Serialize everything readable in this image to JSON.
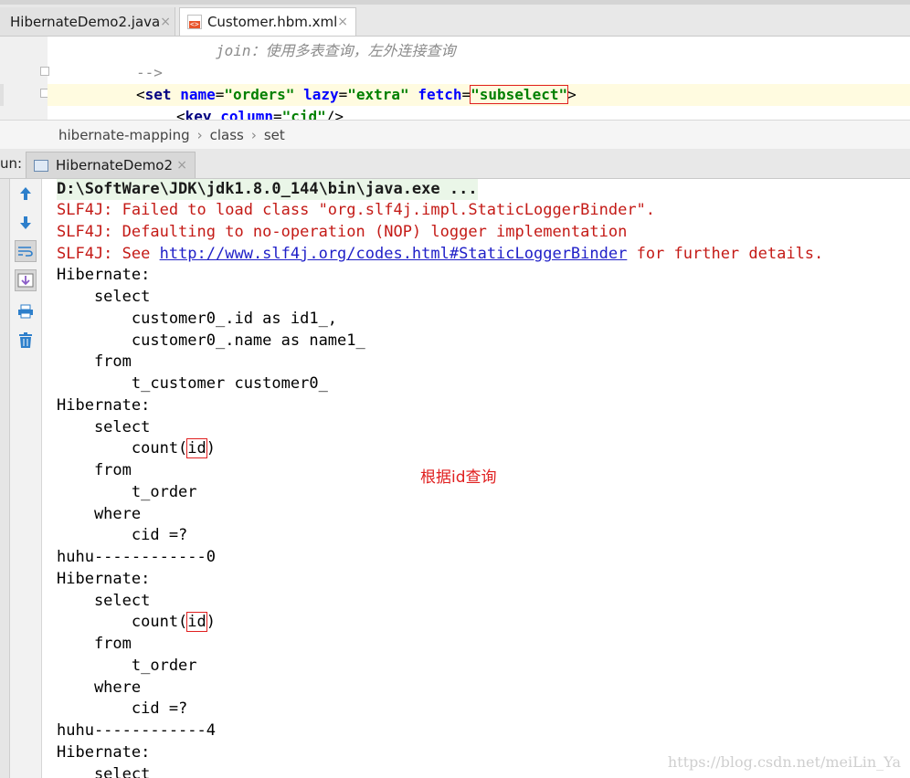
{
  "tabs": [
    {
      "label": "HibernateDemo2.java",
      "close": "×"
    },
    {
      "label": "Customer.hbm.xml",
      "close": "×"
    }
  ],
  "editor": {
    "line1": "join：使用多表查询，左外连接查询",
    "line2": "-->",
    "line3": {
      "open": "<",
      "tag": "set",
      "attr1": "name",
      "val1": "\"orders\"",
      "attr2": "lazy",
      "val2": "\"extra\"",
      "attr3": "fetch",
      "val3_q1": "\"",
      "val3_word": "subselect",
      "val3_q2": "\"",
      "close": ">"
    },
    "line4": {
      "open": "<",
      "tag": "key",
      "attr": "column",
      "val": "\"cid\"",
      "close": "/>"
    }
  },
  "breadcrumb": [
    "hibernate-mapping",
    "class",
    "set"
  ],
  "breadcrumb_sep": "›",
  "run": {
    "label": "un:",
    "tab_label": "HibernateDemo2",
    "close": "×"
  },
  "console": {
    "cmd": "D:\\SoftWare\\JDK\\jdk1.8.0_144\\bin\\java.exe ...",
    "err1": "SLF4J: Failed to load class \"org.slf4j.impl.StaticLoggerBinder\".",
    "err2": "SLF4J: Defaulting to no-operation (NOP) logger implementation",
    "err3_a": "SLF4J: See ",
    "err3_link": "http://www.slf4j.org/codes.html#StaticLoggerBinder",
    "err3_b": " for further details.",
    "hibernate": "Hibernate:",
    "select": "    select",
    "sel_id": "        customer0_.id as id1_,",
    "sel_name": "        customer0_.name as name1_",
    "from": "    from",
    "from_tbl": "        t_customer customer0_",
    "count_a": "        count(",
    "count_id": "id",
    "count_b": ")",
    "order_tbl": "        t_order",
    "where": "    where",
    "cid": "        cid =?",
    "huhu0": "huhu------------0",
    "huhu4": "huhu------------4"
  },
  "annotation": "根据id查询",
  "watermark": "https://blog.csdn.net/meiLin_Ya"
}
